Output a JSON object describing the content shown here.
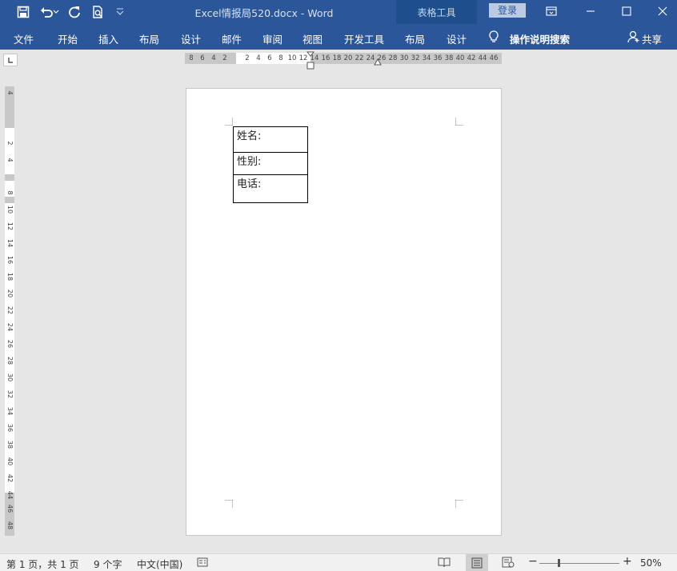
{
  "titlebar": {
    "doc_title": "Excel情报局520.docx  -  Word",
    "context_group": "表格工具",
    "login": "登录",
    "icons": [
      "save-icon",
      "undo-icon",
      "redo-icon",
      "print-preview-icon",
      "customize-qat-icon",
      "ribbon-display-icon",
      "minimize-icon",
      "maximize-icon",
      "close-icon"
    ]
  },
  "ribbon": {
    "tabs": [
      "文件",
      "开始",
      "插入",
      "布局",
      "设计",
      "邮件",
      "审阅",
      "视图",
      "开发工具",
      "布局",
      "设计"
    ],
    "tell_me": "操作说明搜索",
    "share": "共享"
  },
  "hruler": {
    "ticks": [
      "8",
      "6",
      "4",
      "2",
      "2",
      "4",
      "6",
      "8",
      "10",
      "12",
      "14",
      "16",
      "18",
      "20",
      "22",
      "24",
      "26",
      "28",
      "30",
      "32",
      "34",
      "36",
      "38",
      "40",
      "42",
      "44",
      "46"
    ]
  },
  "vruler": {
    "ticks": [
      "4",
      "2",
      "4",
      "8",
      "10",
      "12",
      "14",
      "16",
      "18",
      "20",
      "22",
      "24",
      "26",
      "28",
      "30",
      "32",
      "34",
      "36",
      "38",
      "40",
      "42",
      "44",
      "46",
      "48"
    ]
  },
  "document": {
    "table_rows": [
      "姓名:",
      "性别:",
      "电话:"
    ]
  },
  "statusbar": {
    "page": "第 1 页，共 1 页",
    "words": "9 个字",
    "language": "中文(中国)",
    "zoom": "50%",
    "zoom_percent": 50
  },
  "colors": {
    "brand": "#2b579a",
    "context_tab": "#1f4e8c",
    "workspace": "#e6e6e6"
  }
}
